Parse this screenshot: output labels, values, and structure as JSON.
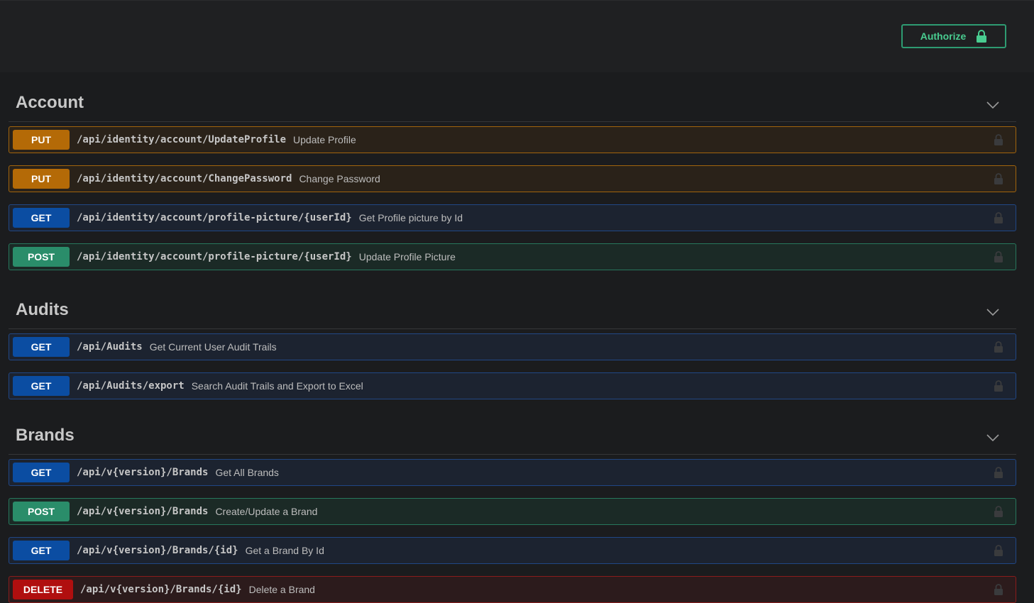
{
  "header": {
    "authorize_label": "Authorize"
  },
  "sections": [
    {
      "title": "Account",
      "operations": [
        {
          "method": "PUT",
          "path": "/api/identity/account/UpdateProfile",
          "summary": "Update Profile"
        },
        {
          "method": "PUT",
          "path": "/api/identity/account/ChangePassword",
          "summary": "Change Password"
        },
        {
          "method": "GET",
          "path": "/api/identity/account/profile-picture/{userId}",
          "summary": "Get Profile picture by Id"
        },
        {
          "method": "POST",
          "path": "/api/identity/account/profile-picture/{userId}",
          "summary": "Update Profile Picture"
        }
      ]
    },
    {
      "title": "Audits",
      "operations": [
        {
          "method": "GET",
          "path": "/api/Audits",
          "summary": "Get Current User Audit Trails"
        },
        {
          "method": "GET",
          "path": "/api/Audits/export",
          "summary": "Search Audit Trails and Export to Excel"
        }
      ]
    },
    {
      "title": "Brands",
      "operations": [
        {
          "method": "GET",
          "path": "/api/v{version}/Brands",
          "summary": "Get All Brands"
        },
        {
          "method": "POST",
          "path": "/api/v{version}/Brands",
          "summary": "Create/Update a Brand"
        },
        {
          "method": "GET",
          "path": "/api/v{version}/Brands/{id}",
          "summary": "Get a Brand By Id"
        },
        {
          "method": "DELETE",
          "path": "/api/v{version}/Brands/{id}",
          "summary": "Delete a Brand"
        }
      ]
    }
  ],
  "colors": {
    "put": "#b46a07",
    "get": "#0b4da2",
    "post": "#2a8d6a",
    "delete": "#b00f0f",
    "authorize": "#49cc90"
  },
  "icons": {
    "authorize": "lock-icon",
    "operation_lock": "lock-icon",
    "section_toggle": "chevron-down-icon"
  }
}
